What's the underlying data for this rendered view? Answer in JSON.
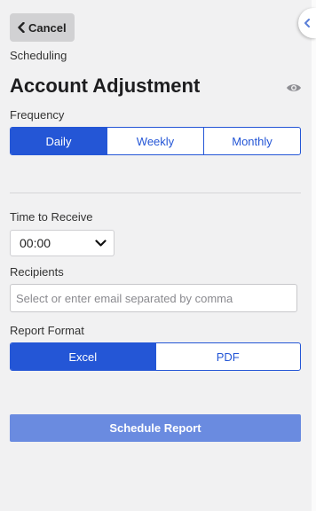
{
  "header": {
    "cancel_label": "Cancel",
    "eyebrow": "Scheduling",
    "title": "Account Adjustment"
  },
  "frequency": {
    "label": "Frequency",
    "options": [
      "Daily",
      "Weekly",
      "Monthly"
    ],
    "selected": "Daily"
  },
  "time": {
    "label": "Time to Receive",
    "value": "00:00"
  },
  "recipients": {
    "label": "Recipients",
    "placeholder": "Select or enter email separated by comma",
    "value": ""
  },
  "format": {
    "label": "Report Format",
    "options": [
      "Excel",
      "PDF"
    ],
    "selected": "Excel"
  },
  "actions": {
    "schedule_label": "Schedule Report"
  },
  "colors": {
    "accent": "#2456d6",
    "button_disabled": "#6a8be0",
    "background": "#f1f1f2"
  },
  "icons": {
    "cancel": "chevron-left-icon",
    "visibility": "eye-icon",
    "dropdown": "chevron-down-icon",
    "side_tab": "chevron-left-icon"
  }
}
